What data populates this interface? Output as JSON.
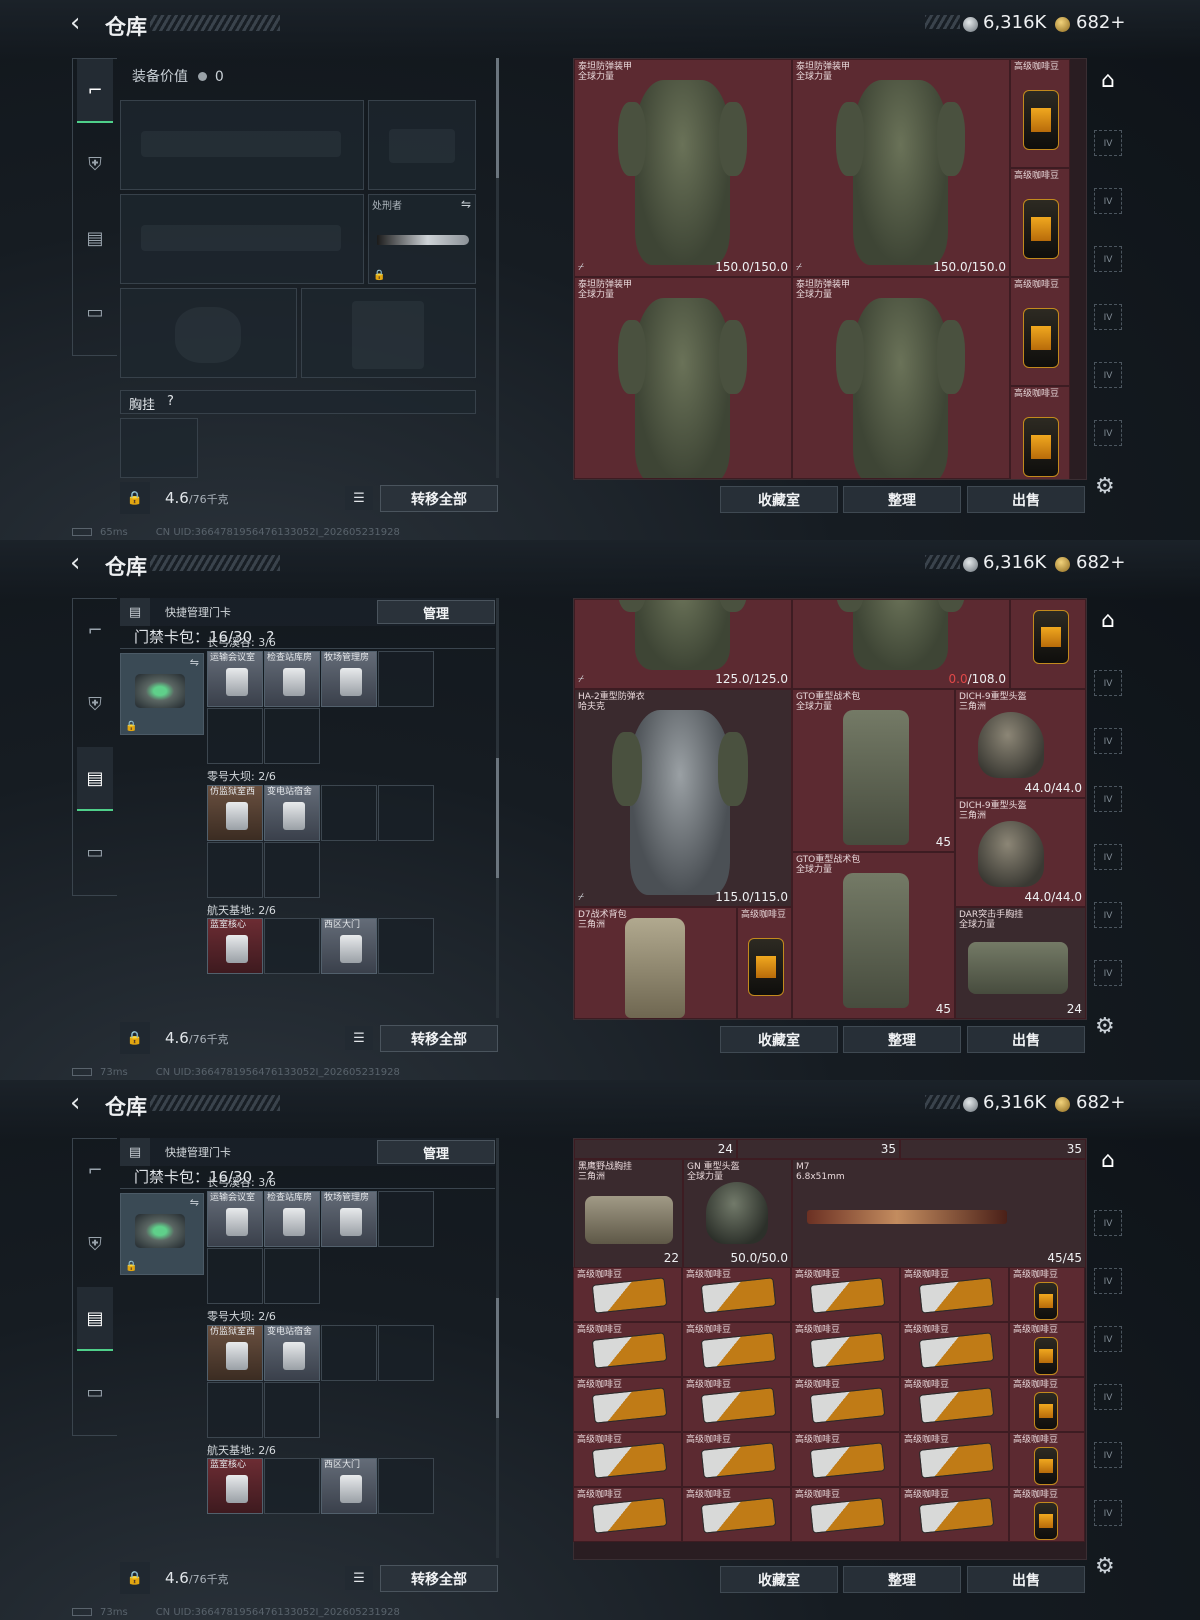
{
  "header": {
    "title": "仓库",
    "currency_silver": "6,316K",
    "currency_gold": "682",
    "gold_plus": "+"
  },
  "icons": {
    "back": "back-arrow-icon",
    "silver": "silver-coin-icon",
    "gold": "gold-coin-icon",
    "home": "home-icon",
    "gear": "gear-icon",
    "lock": "lock-icon",
    "list": "list-icon",
    "swap": "swap-icon"
  },
  "screens": [
    {
      "rail_active": 0,
      "left": {
        "equip_value_label": "装备价值",
        "equip_value": "0",
        "knife_label": "处刑者",
        "chest_rig_label": "胸挂",
        "chest_rig_hint": "?"
      },
      "bottom": {
        "weight": "4.6",
        "weight_max": "/76千克",
        "move_all": "转移全部"
      },
      "items": [
        {
          "name": "泰坦防弹装甲\n全球力量",
          "dur": "150.0/150.0"
        },
        {
          "name": "泰坦防弹装甲\n全球力量",
          "dur": "150.0/150.0"
        },
        {
          "name": "泰坦防弹装甲\n全球力量",
          "dur": ""
        },
        {
          "name": "泰坦防弹装甲\n全球力量",
          "dur": ""
        },
        {
          "name": "高级咖啡豆"
        },
        {
          "name": "高级咖啡豆"
        },
        {
          "name": "高级咖啡豆"
        },
        {
          "name": "高级咖啡豆"
        }
      ],
      "status": {
        "ping": "65ms",
        "uid": "CN UID:3664781956476133052I_202605231928"
      }
    },
    {
      "rail_active": 2,
      "card": {
        "header": "快捷管理门卡",
        "manage": "管理",
        "pack_label": "门禁卡包：16/30",
        "pack_hint": "?",
        "zones": [
          {
            "name": "长弓溪谷: 3/6",
            "cards": [
              "运输会议室",
              "检查站库房",
              "牧场管理房"
            ]
          },
          {
            "name": "零号大坝: 2/6",
            "cards": [
              "仿监狱室西",
              "变电站宿舍"
            ]
          },
          {
            "name": "航天基地: 2/6",
            "cards": [
              "蓝室核心",
              "西区大门"
            ]
          }
        ]
      },
      "bottom": {
        "weight": "4.6",
        "weight_max": "/76千克",
        "move_all": "转移全部"
      },
      "items": [
        {
          "name": "",
          "dur": "125.0/125.0"
        },
        {
          "name": "",
          "dur_red": "0.0",
          "dur": "/108.0"
        },
        {
          "name": "HA-2重型防弹衣\n哈夫克",
          "dur": "115.0/115.0"
        },
        {
          "name": "GTO重型战术包\n全球力量",
          "count": "45"
        },
        {
          "name": "DICH-9重型头盔\n三角洲",
          "dur": "44.0/44.0"
        },
        {
          "name": "DICH-9重型头盔\n三角洲",
          "dur": "44.0/44.0"
        },
        {
          "name": "GTO重型战术包\n全球力量",
          "count": "45"
        },
        {
          "name": "D7战术背包\n三角洲"
        },
        {
          "name": "高级咖啡豆"
        },
        {
          "name": "DAR突击手胸挂\n全球力量",
          "count": "24"
        }
      ],
      "status": {
        "ping": "73ms",
        "uid": "CN UID:3664781956476133052I_202605231928"
      }
    },
    {
      "rail_active": 2,
      "card": {
        "header": "快捷管理门卡",
        "manage": "管理",
        "pack_label": "门禁卡包：16/30",
        "pack_hint": "?",
        "zones": [
          {
            "name": "长弓溪谷: 3/6",
            "cards": [
              "运输会议室",
              "检查站库房",
              "牧场管理房"
            ]
          },
          {
            "name": "零号大坝: 2/6",
            "cards": [
              "仿监狱室西",
              "变电站宿舍"
            ]
          },
          {
            "name": "航天基地: 2/6",
            "cards": [
              "蓝室核心",
              "西区大门"
            ]
          }
        ]
      },
      "bottom": {
        "weight": "4.6",
        "weight_max": "/76千克",
        "move_all": "转移全部"
      },
      "top_counts": [
        "24",
        "35",
        "35"
      ],
      "items": [
        {
          "name": "黑鹰野战胸挂\n三角洲",
          "count": "22"
        },
        {
          "name": "GN 重型头盔\n全球力量",
          "dur": "50.0/50.0"
        },
        {
          "name": "M7\n6.8x51mm",
          "dur": "45/45"
        },
        {
          "name": "高级咖啡豆"
        }
      ],
      "status": {
        "ping": "73ms",
        "uid": "CN UID:3664781956476133052I_202605231928"
      }
    }
  ],
  "footer_buttons": {
    "collection": "收藏室",
    "sort": "整理",
    "sell": "出售"
  },
  "right_rail_tiers": [
    "IV",
    "IV",
    "IV",
    "IV",
    "IV",
    "IV",
    "IV"
  ]
}
